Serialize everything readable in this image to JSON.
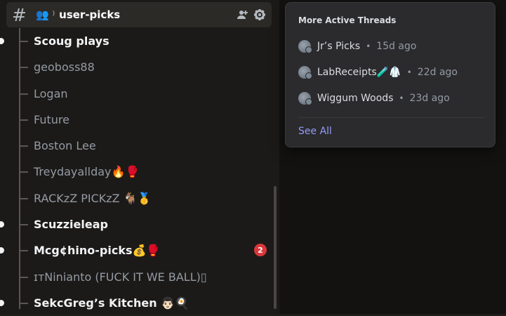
{
  "channel": {
    "name": "user-picks",
    "emoji": "👥 ⁾"
  },
  "header_icons": {
    "threads": "threads-people-icon",
    "settings": "gear-icon"
  },
  "threads": [
    {
      "label": "Scoug plays",
      "unread": true
    },
    {
      "label": "geoboss88",
      "unread": false
    },
    {
      "label": "Logan",
      "unread": false
    },
    {
      "label": "Future",
      "unread": false
    },
    {
      "label": "Boston Lee",
      "unread": false
    },
    {
      "label": "Treydayallday🔥🥊",
      "unread": false
    },
    {
      "label": "RACKzZ PICKzZ 🐐🥇",
      "unread": false
    },
    {
      "label": "Scuzzieleap",
      "unread": true
    },
    {
      "label": "Mcg¢hino-picks💰🥊",
      "unread": true,
      "badge": "2"
    },
    {
      "label": "ɪᴛNinianto (FUCK IT WE BALL)▯",
      "unread": false
    },
    {
      "label": "SekcGreg’s Kitchen 👨🏻🍳",
      "unread": true
    }
  ],
  "popout": {
    "title": "More Active Threads",
    "items": [
      {
        "name": "Jr’s Picks",
        "age": "15d ago"
      },
      {
        "name": "LabReceipts🧪🥼",
        "age": "22d ago"
      },
      {
        "name": "Wiggum Woods",
        "age": "23d ago"
      }
    ],
    "separator": "•",
    "see_all": "See All"
  }
}
